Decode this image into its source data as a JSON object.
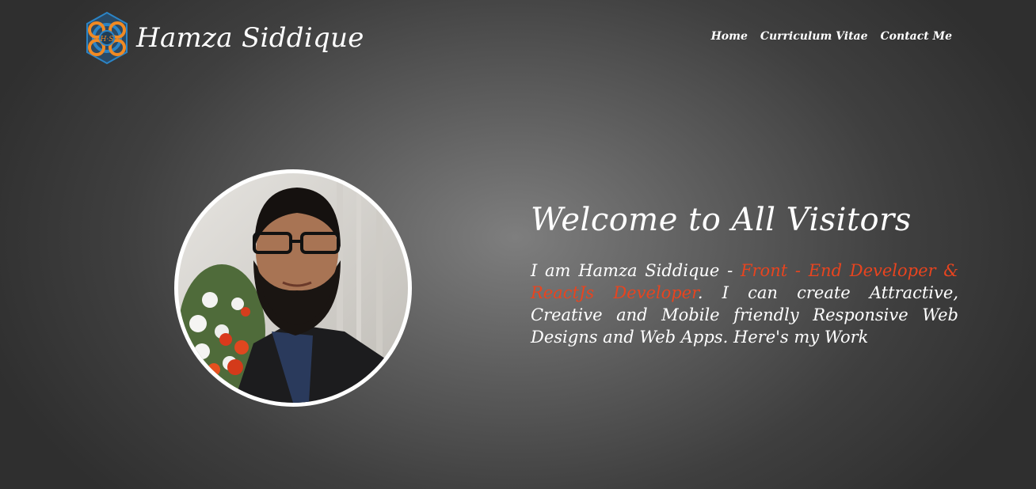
{
  "header": {
    "brand_name": "Hamza Siddique",
    "logo_monogram": "H·S",
    "logo_icon": "molecule-logo-icon",
    "nav": [
      {
        "label": "Home"
      },
      {
        "label": "Curriculum Vitae"
      },
      {
        "label": "Contact Me"
      }
    ]
  },
  "hero": {
    "title": "Welcome to All Visitors",
    "intro_prefix": "I am Hamza Siddique - ",
    "highlight": "Front - End Developer & ReactJs Developer",
    "intro_suffix": ". I can create Attractive, Creative and Mobile friendly Responsive Web Designs and Web Apps. Here's my Work",
    "avatar": "profile-photo"
  },
  "colors": {
    "accent": "#e8441f",
    "text": "#ffffff",
    "logo_orange": "#f08a24",
    "logo_blue": "#2b84c6"
  }
}
